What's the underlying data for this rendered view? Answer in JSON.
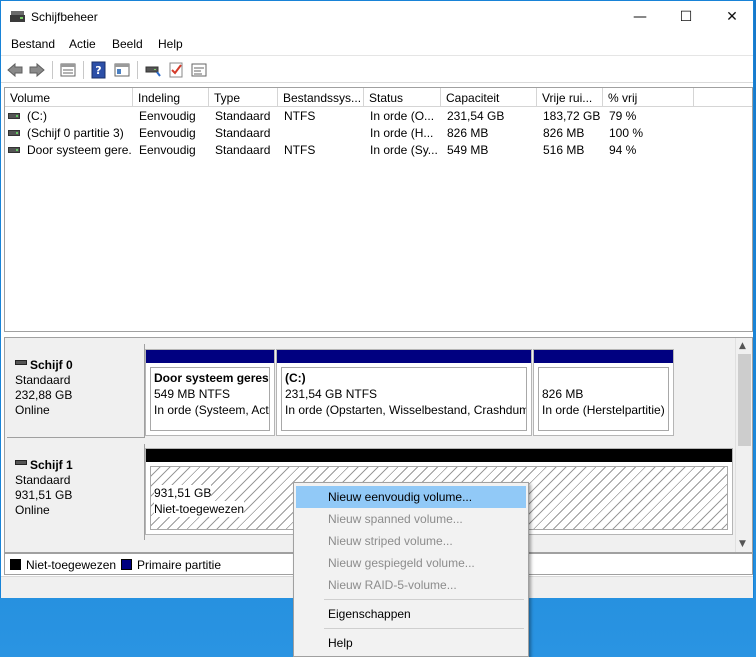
{
  "window": {
    "title": "Schijfbeheer"
  },
  "window_controls": {
    "minimize": "—",
    "maximize": "☐",
    "close": "✕"
  },
  "menu": [
    "Bestand",
    "Actie",
    "Beeld",
    "Help"
  ],
  "toolbar": {
    "icons": [
      "back-arrow-icon",
      "forward-arrow-icon",
      "list-view-icon",
      "help-icon",
      "console-tree-icon",
      "connect-drive-icon",
      "check-icon",
      "properties-icon"
    ]
  },
  "volume_table": {
    "columns": [
      "Volume",
      "Indeling",
      "Type",
      "Bestandssys...",
      "Status",
      "Capaciteit",
      "Vrije rui...",
      "% vrij"
    ],
    "rows": [
      [
        "(C:)",
        "Eenvoudig",
        "Standaard",
        "NTFS",
        "In orde (O...",
        "231,54 GB",
        "183,72 GB",
        "79 %"
      ],
      [
        "(Schijf 0 partitie 3)",
        "Eenvoudig",
        "Standaard",
        "",
        "In orde (H...",
        "826 MB",
        "826 MB",
        "100 %"
      ],
      [
        "Door systeem gere...",
        "Eenvoudig",
        "Standaard",
        "NTFS",
        "In orde (Sy...",
        "549 MB",
        "516 MB",
        "94 %"
      ]
    ]
  },
  "disks": [
    {
      "name": "Schijf 0",
      "type": "Standaard",
      "size": "232,88 GB",
      "state": "Online",
      "partitions": [
        {
          "title": "Door systeem gereserveerd",
          "line1": "549 MB NTFS",
          "line2": "In orde (Systeem, Actief, Primaire partitie)"
        },
        {
          "title": "(C:)",
          "line1": "231,54 GB NTFS",
          "line2": "In orde (Opstarten, Wisselbestand, Crashdump, Primaire partitie)"
        },
        {
          "title": "",
          "line1": "826 MB",
          "line2": "In orde (Herstelpartitie)"
        }
      ]
    },
    {
      "name": "Schijf 1",
      "type": "Standaard",
      "size": "931,51 GB",
      "state": "Online",
      "partitions": [
        {
          "title": "",
          "line1": "931,51 GB",
          "line2": "Niet-toegewezen"
        }
      ]
    }
  ],
  "legend": [
    {
      "label": "Niet-toegewezen",
      "color": "#000000"
    },
    {
      "label": "Primaire partitie",
      "color": "#000080"
    }
  ],
  "context_menu": {
    "items": [
      {
        "label": "Nieuw eenvoudig volume...",
        "state": "highlighted"
      },
      {
        "label": "Nieuw spanned volume...",
        "state": "disabled"
      },
      {
        "label": "Nieuw striped volume...",
        "state": "disabled"
      },
      {
        "label": "Nieuw gespiegeld volume...",
        "state": "disabled"
      },
      {
        "label": "Nieuw RAID-5-volume...",
        "state": "disabled"
      },
      {
        "label": "Eigenschappen",
        "state": "enabled"
      },
      {
        "label": "Help",
        "state": "enabled"
      }
    ]
  },
  "colors": {
    "primary_partition": "#000080",
    "unallocated": "#000000",
    "menu_highlight": "#91c9f7",
    "window_border": "#1883d7"
  }
}
